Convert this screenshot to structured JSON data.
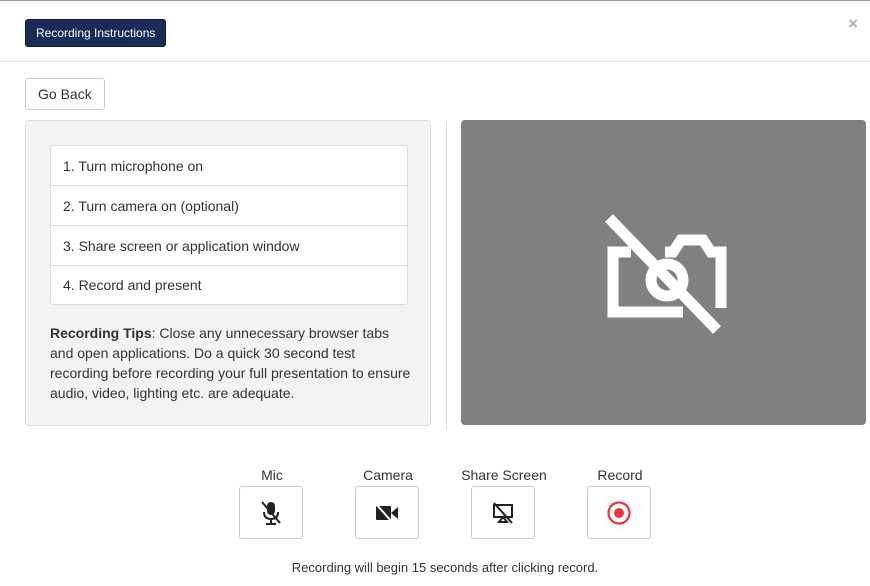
{
  "header": {
    "title_button": "Recording Instructions",
    "close_symbol": "×"
  },
  "go_back_label": "Go Back",
  "steps": [
    "1. Turn microphone on",
    "2. Turn camera on (optional)",
    "3. Share screen or application window",
    "4. Record and present"
  ],
  "tips": {
    "heading": "Recording Tips",
    "text": ": Close any unnecessary browser tabs and open applications. Do a quick 30 second test recording before recording your full presentation to ensure audio, video, lighting etc. are adequate."
  },
  "preview": {
    "icon": "camera-off-icon"
  },
  "controls": {
    "mic": {
      "label": "Mic",
      "icon": "mic-off-icon"
    },
    "camera": {
      "label": "Camera",
      "icon": "video-off-icon"
    },
    "share": {
      "label": "Share Screen",
      "icon": "screen-share-off-icon"
    },
    "record": {
      "label": "Record",
      "icon": "record-icon"
    }
  },
  "colors": {
    "title_bg": "#1a2b57",
    "preview_bg": "#808080",
    "record_red": "#e8343a"
  },
  "footnote": "Recording will begin 15 seconds after clicking record."
}
